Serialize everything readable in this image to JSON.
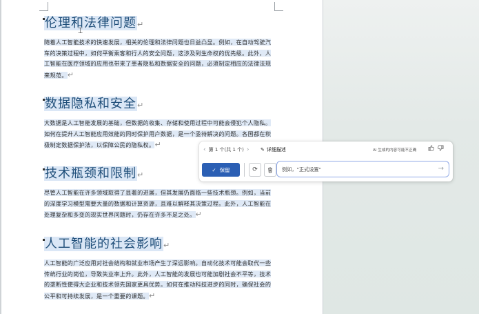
{
  "document": {
    "sections": [
      {
        "heading": "伦理和法律问题",
        "paragraph": "随着人工智能技术的快速发展，相关的伦理和法律问题也日益凸显。例如，在自动驾驶汽车的决策过程中，如何平衡乘客和行人的安全问题，这涉及到生命权的优先级。此外，人工智能在医疗领域的应用也带来了患者隐私和数据安全的问题，必须制定相应的法律法规来规范。"
      },
      {
        "heading": "数据隐私和安全",
        "paragraph": "大数据是人工智能发展的基础，但数据的收集、存储和使用过程中可能会侵犯个人隐私。如何在提升人工智能应用效能的同时保护用户数据，是一个亟待解决的问题。各国都在积极制定数据保护法，以保障公民的隐私权。"
      },
      {
        "heading": "技术瓶颈和限制",
        "paragraph": "尽管人工智能在许多领域取得了显著的进展，但其发展仍面临一些技术瓶颈。例如，当前的深度学习模型需要大量的数据和计算资源，且难以解释其决策过程。此外，人工智能在处理复杂和多变的现实世界问题时，仍存在许多不足之处。"
      },
      {
        "heading": "人工智能的社会影响",
        "paragraph": "人工智能的广泛应用对社会结构和就业市场产生了深远影响。自动化技术可能会取代一些传统行业的岗位，导致失业率上升。此外，人工智能的发展也可能加剧社会不平等，技术的垄断性使得大企业和技术领先国家更具优势。如何在推动科技进步的同时，确保社会的公平和可持续发展，是一个重要的课题。"
      }
    ],
    "paragraph_mark": "↵"
  },
  "copilot": {
    "nav_label": "第 1 个(共 1 个)",
    "detail_label": "详细描述",
    "disclaimer": "AI 生成的内容可能不正确",
    "keep_label": "保留",
    "input_placeholder": "例如，\"正式设置\""
  },
  "icons": {
    "chevron_left": "‹",
    "chevron_right": "›",
    "edit": "✎",
    "thumbs_up": "👍",
    "thumbs_down": "👎",
    "check": "✓",
    "regenerate": "⟳",
    "delete": "🗑",
    "send": "→"
  }
}
